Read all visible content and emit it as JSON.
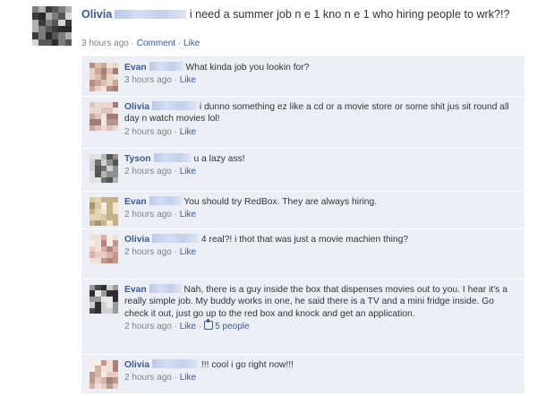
{
  "post": {
    "author": "Olivia",
    "text": "i need a summer job n e 1 kno n e 1 who hiring people to wrk?!?",
    "time": "3 hours ago",
    "separator": "·",
    "comment_label": "Comment",
    "like_label": "Like"
  },
  "comments": [
    {
      "author": "Evan",
      "text": "What kinda job you lookin for?",
      "time": "3 hours ago",
      "like_label": "Like"
    },
    {
      "author": "Olivia",
      "text": "i dunno something ez like a cd or a movie store or some shit jus sit round all day n watch movies lol!",
      "time": "2 hours ago",
      "like_label": "Like"
    },
    {
      "author": "Tyson",
      "text": "u a lazy ass!",
      "time": "2 hours ago",
      "like_label": "Like"
    },
    {
      "author": "Evan",
      "text": "You should try RedBox. They are always hiring.",
      "time": "2 hours ago",
      "like_label": "Like"
    },
    {
      "author": "Olivia",
      "text": "4 real?! i thot that was just a movie machien thing?",
      "time": "2 hours ago",
      "like_label": "Like"
    },
    {
      "author": "Evan",
      "text": "Nah, there is a guy inside the box that dispenses movies out to you. I hear it's a really simple job. My buddy works in one, he said there is a TV and a mini fridge inside. Go check it out, just go up to the red box and knock and get an application.",
      "time": "2 hours ago",
      "like_label": "Like",
      "likes_count": "5 people"
    },
    {
      "author": "Olivia",
      "text": "!!! cool i go right now!!!",
      "time": "2 hours ago",
      "like_label": "Like"
    }
  ],
  "colors": {
    "link": "#3b5998",
    "thread_background": "#eceff5",
    "meta_text": "#808080"
  },
  "icons": [
    "blurred-avatar",
    "thumbs-up-icon"
  ]
}
